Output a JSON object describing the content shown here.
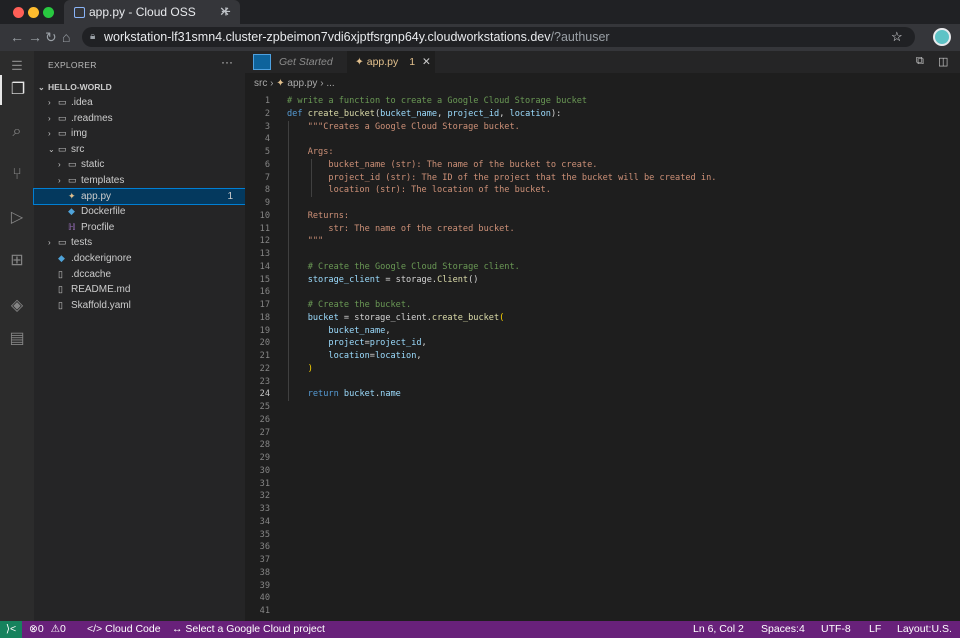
{
  "browser": {
    "tab_title": "app.py - Cloud OSS",
    "tab_close": "✕",
    "new_tab": "+",
    "url_host": "workstation-lf31smn4.cluster-zpbeimon7vdi6xjptfsrgnp64y.cloudworkstations.dev",
    "url_rest": "/?authuser",
    "traffic_colors": [
      "#ff5f57",
      "#febc2e",
      "#28c840"
    ]
  },
  "explorer": {
    "title": "EXPLORER",
    "more": "···",
    "root": "HELLO-WORLD",
    "items": [
      {
        "label": ".idea",
        "kind": "folder",
        "depth": 1,
        "chev": "›"
      },
      {
        "label": ".readmes",
        "kind": "folder",
        "depth": 1,
        "chev": "›"
      },
      {
        "label": "img",
        "kind": "folder",
        "depth": 1,
        "chev": "›"
      },
      {
        "label": "src",
        "kind": "folder",
        "depth": 1,
        "chev": "⌄"
      },
      {
        "label": "static",
        "kind": "folder",
        "depth": 2,
        "chev": "›"
      },
      {
        "label": "templates",
        "kind": "folder",
        "depth": 2,
        "chev": "›"
      },
      {
        "label": "app.py",
        "kind": "python-file",
        "depth": 2,
        "chev": "",
        "badge": "1",
        "selected": true
      },
      {
        "label": "Dockerfile",
        "kind": "docker-file",
        "depth": 2,
        "chev": ""
      },
      {
        "label": "Procfile",
        "kind": "procfile",
        "depth": 2,
        "chev": ""
      },
      {
        "label": "tests",
        "kind": "folder",
        "depth": 1,
        "chev": "›"
      },
      {
        "label": ".dockerignore",
        "kind": "docker-file",
        "depth": 1,
        "chev": ""
      },
      {
        "label": ".dccache",
        "kind": "file",
        "depth": 1,
        "chev": ""
      },
      {
        "label": "README.md",
        "kind": "file",
        "depth": 1,
        "chev": ""
      },
      {
        "label": "Skaffold.yaml",
        "kind": "file",
        "depth": 1,
        "chev": ""
      }
    ]
  },
  "editor_tabs": {
    "get_started": "Get Started",
    "active": "app.py",
    "active_badge": "1",
    "active_close": "✕"
  },
  "breadcrumb": {
    "folder": "src",
    "file": "app.py",
    "more": "..."
  },
  "code": {
    "current_line": 24,
    "line_count": 41,
    "lines": [
      [
        [
          "c",
          "# write a function to create a Google Cloud Storage bucket"
        ]
      ],
      [
        [
          "k",
          "def "
        ],
        [
          "f",
          "create_bucket"
        ],
        [
          "p",
          "("
        ],
        [
          "v",
          "bucket_name"
        ],
        [
          "p",
          ", "
        ],
        [
          "v",
          "project_id"
        ],
        [
          "p",
          ", "
        ],
        [
          "v",
          "location"
        ],
        [
          "p",
          "):"
        ]
      ],
      [
        [
          "s",
          "    \"\"\"Creates a Google Cloud Storage bucket."
        ]
      ],
      [],
      [
        [
          "s",
          "    Args:"
        ]
      ],
      [
        [
          "s",
          "        bucket_name (str): The name of the bucket to create."
        ]
      ],
      [
        [
          "s",
          "        project_id (str): The ID of the project that the bucket will be created in."
        ]
      ],
      [
        [
          "s",
          "        location (str): The location of the bucket."
        ]
      ],
      [],
      [
        [
          "s",
          "    Returns:"
        ]
      ],
      [
        [
          "s",
          "        str: The name of the created bucket."
        ]
      ],
      [
        [
          "s",
          "    \"\"\""
        ]
      ],
      [],
      [
        [
          "c",
          "    # Create the Google Cloud Storage client."
        ]
      ],
      [
        [
          "v",
          "    storage_client"
        ],
        [
          "p",
          " = storage."
        ],
        [
          "f",
          "Client"
        ],
        [
          "p",
          "()"
        ]
      ],
      [],
      [
        [
          "c",
          "    # Create the bucket."
        ]
      ],
      [
        [
          "v",
          "    bucket"
        ],
        [
          "p",
          " = storage_client."
        ],
        [
          "f",
          "create_bucket"
        ],
        [
          "y",
          "("
        ]
      ],
      [
        [
          "v",
          "        bucket_name"
        ],
        [
          "p",
          ","
        ]
      ],
      [
        [
          "v",
          "        project"
        ],
        [
          "p",
          "="
        ],
        [
          "v",
          "project_id"
        ],
        [
          "p",
          ","
        ]
      ],
      [
        [
          "v",
          "        location"
        ],
        [
          "p",
          "="
        ],
        [
          "v",
          "location"
        ],
        [
          "p",
          ","
        ]
      ],
      [
        [
          "y",
          "    )"
        ]
      ],
      [],
      [
        [
          "k",
          "    return "
        ],
        [
          "v",
          "bucket"
        ],
        [
          "p",
          "."
        ],
        [
          "v",
          "name"
        ]
      ]
    ]
  },
  "status": {
    "remote": "⟩<",
    "errors": "0",
    "warnings": "0",
    "cloud_code": "Cloud Code",
    "project": "Select a Google Cloud project",
    "position": "Ln 6, Col 2",
    "spaces": "Spaces:4",
    "encoding": "UTF-8",
    "eol": "LF",
    "layout": "Layout:U.S."
  },
  "colors": {
    "comment": "#6a9955",
    "keyword": "#569cd6",
    "function": "#dcdcaa",
    "string": "#ce9178",
    "variable": "#9cdcfe",
    "paren": "#ffd700",
    "plain": "#d4d4d4",
    "status_bg": "#68217a",
    "remote_bg": "#16825d"
  }
}
